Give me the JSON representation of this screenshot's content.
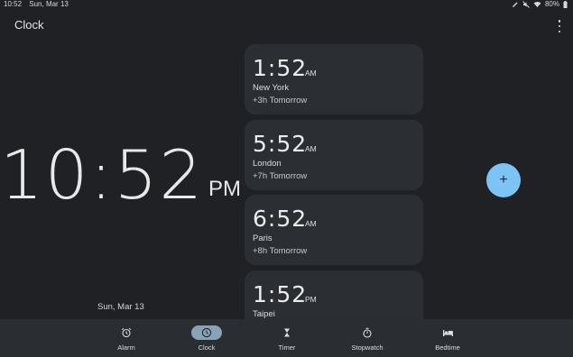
{
  "status_bar": {
    "time": "10:52",
    "date": "Sun, Mar 13",
    "battery": "80%"
  },
  "app": {
    "title": "Clock"
  },
  "main_clock": {
    "time": "10:52",
    "ampm": "PM",
    "date": "Sun, Mar 13"
  },
  "cities": [
    {
      "time": "1:52",
      "ampm": "AM",
      "name": "New York",
      "diff": "+3h Tomorrow"
    },
    {
      "time": "5:52",
      "ampm": "AM",
      "name": "London",
      "diff": "+7h Tomorrow"
    },
    {
      "time": "6:52",
      "ampm": "AM",
      "name": "Paris",
      "diff": "+8h Tomorrow"
    },
    {
      "time": "1:52",
      "ampm": "PM",
      "name": "Taipei",
      "diff": ""
    }
  ],
  "fab": {
    "label": "+"
  },
  "nav": {
    "active": "clock",
    "items": [
      {
        "label": "Alarm",
        "icon": "alarm-icon"
      },
      {
        "label": "Clock",
        "icon": "clock-icon"
      },
      {
        "label": "Timer",
        "icon": "hourglass-icon"
      },
      {
        "label": "Stopwatch",
        "icon": "stopwatch-icon"
      },
      {
        "label": "Bedtime",
        "icon": "bed-icon"
      }
    ]
  },
  "colors": {
    "background": "#1f2124",
    "card": "#2b2e33",
    "fab": "#7cc4f5",
    "nav_active_pill": "#8aa2b5"
  }
}
